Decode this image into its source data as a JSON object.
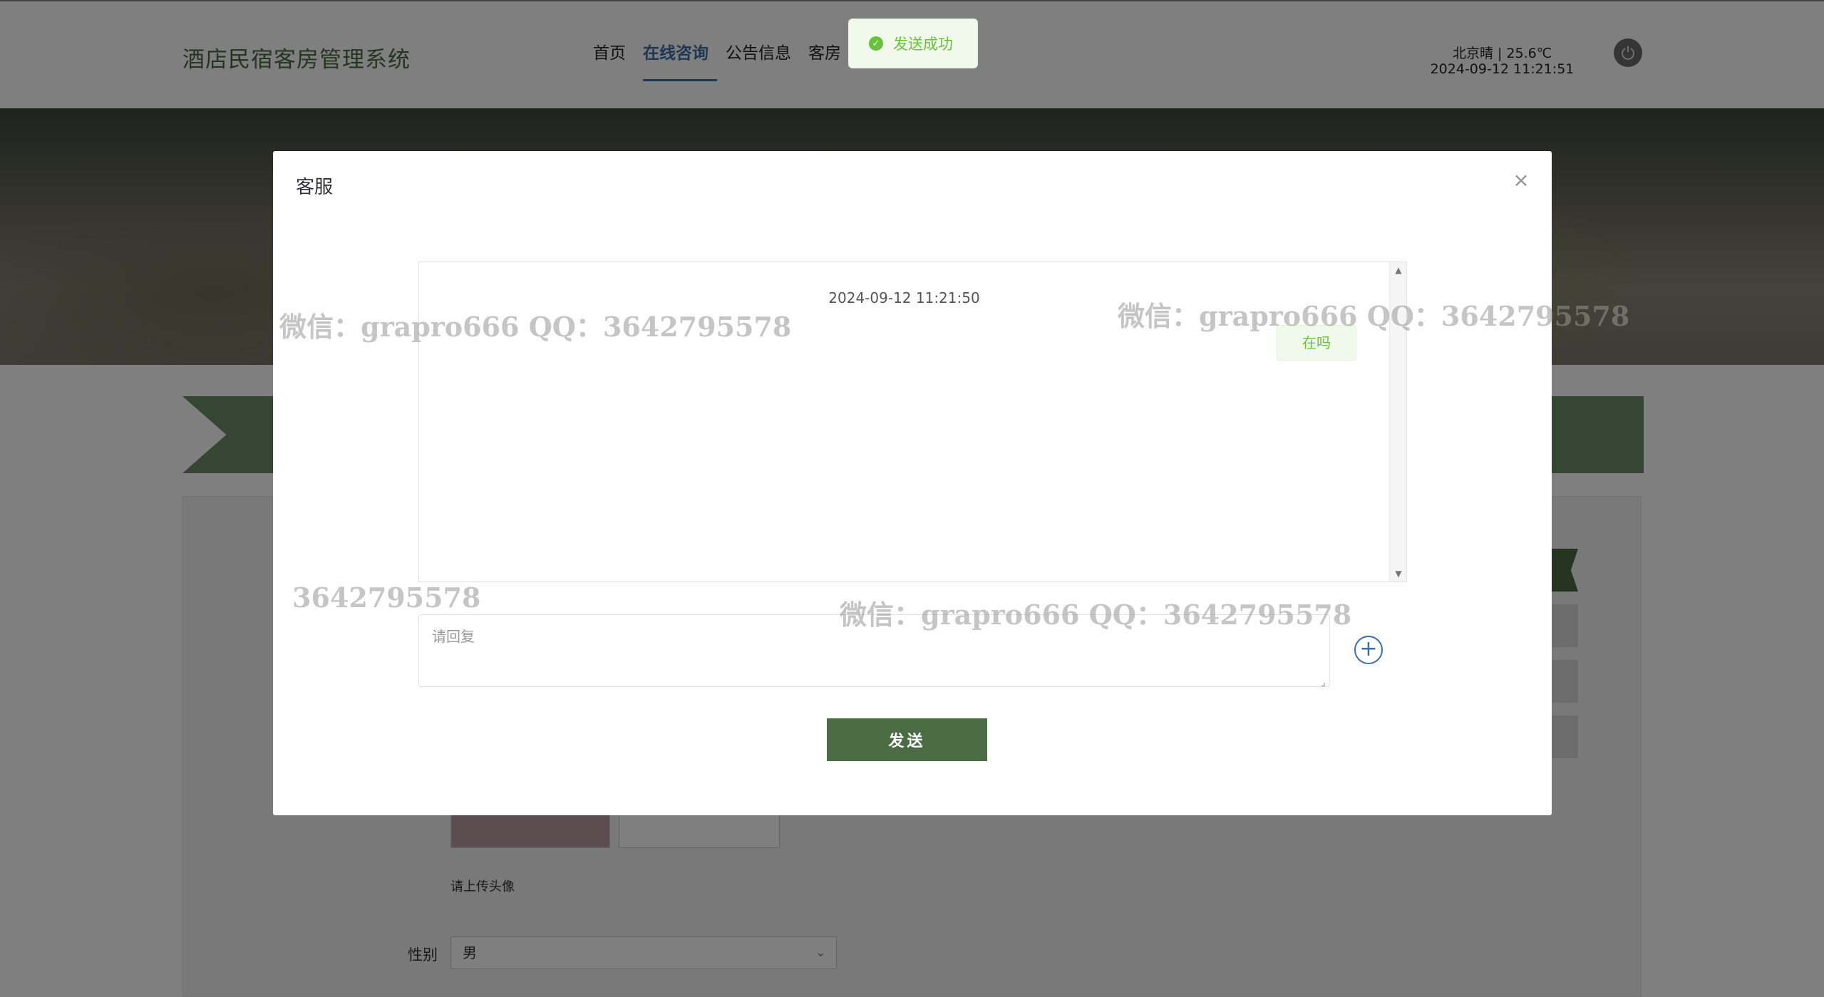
{
  "header": {
    "logo": "酒店民宿客房管理系统",
    "nav": [
      {
        "label": "首页",
        "active": false
      },
      {
        "label": "在线咨询",
        "active": true
      },
      {
        "label": "公告信息",
        "active": false
      },
      {
        "label": "客房",
        "active": false
      }
    ],
    "weather": "北京晴 | 25.6℃",
    "datetime": "2024-09-12   11:21:51",
    "power_icon": "power-icon"
  },
  "toast": {
    "icon": "check-circle-icon",
    "text": "发送成功",
    "color": "#67c23a"
  },
  "page": {
    "upload_tip": "请上传头像",
    "gender_label": "性别",
    "gender_value": "男"
  },
  "modal": {
    "title": "客服",
    "close_icon": "close-icon",
    "messages": [
      {
        "time": "2024-09-12 11:21:50",
        "text": "在吗",
        "side": "right"
      }
    ],
    "reply_placeholder": "请回复",
    "add_icon": "plus-circle-icon",
    "send_label": "发送"
  },
  "watermarks": [
    "微信：grapro666 QQ：3642795578",
    "微信：grapro666 QQ：3642795578",
    "3642795578",
    "微信：grapro666 QQ：3642795578"
  ],
  "colors": {
    "brand": "#4a6b44",
    "accent": "#3a6ea8",
    "success": "#67c23a"
  }
}
